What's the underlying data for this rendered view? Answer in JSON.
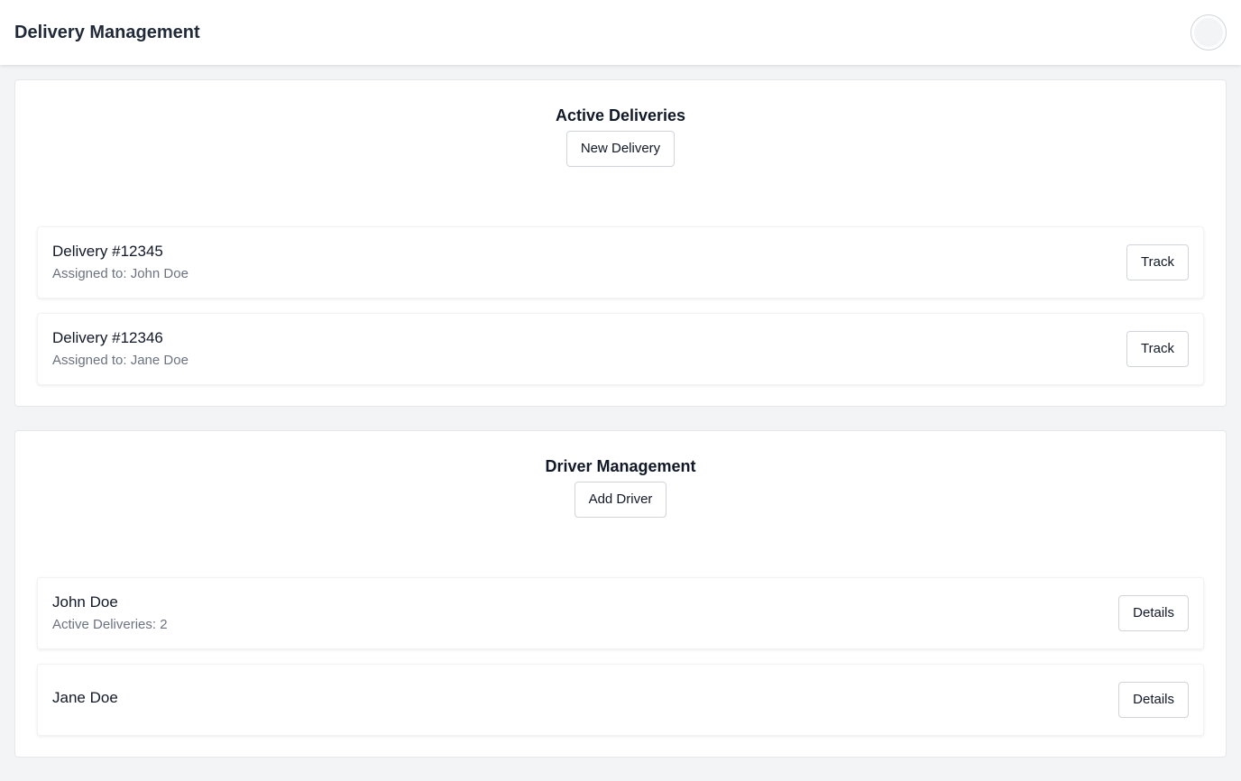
{
  "header": {
    "title": "Delivery Management"
  },
  "deliveries": {
    "title": "Active Deliveries",
    "new_button": "New Delivery",
    "items": [
      {
        "title": "Delivery #12345",
        "subtitle": "Assigned to: John Doe",
        "action": "Track"
      },
      {
        "title": "Delivery #12346",
        "subtitle": "Assigned to: Jane Doe",
        "action": "Track"
      }
    ]
  },
  "drivers": {
    "title": "Driver Management",
    "add_button": "Add Driver",
    "items": [
      {
        "title": "John Doe",
        "subtitle": "Active Deliveries: 2",
        "action": "Details"
      },
      {
        "title": "Jane Doe",
        "subtitle": "",
        "action": "Details"
      }
    ]
  }
}
